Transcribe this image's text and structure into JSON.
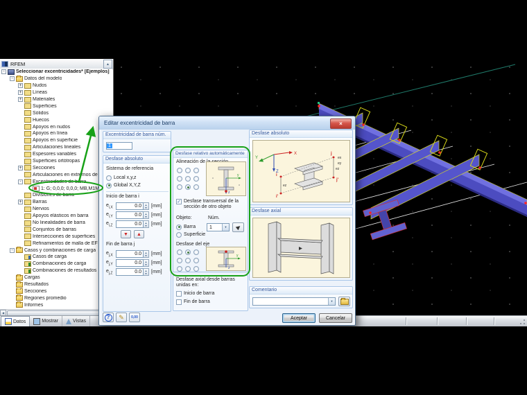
{
  "app": {
    "name": "RFEM"
  },
  "glyphs": {
    "close": "×",
    "spin_up": "▴",
    "spin_down": "▾",
    "combo_arrow": "▾",
    "scroll_up": "▲",
    "scroll_left": "◀",
    "scroll_right": "▶",
    "copy_down": "▼",
    "copy_up": "▲",
    "pencil": "✎",
    "help": "?",
    "units": "0,00",
    "check": "✓",
    "tree_plus": "+",
    "tree_minus": "-"
  },
  "colors": {
    "annotation_green": "#17a117",
    "beam_purple": "#5757c8",
    "beam_highlight_yellow": "#d8d818",
    "selection_blue": "#3399ff",
    "group_border": "#a9c6e8",
    "group_header_text": "#34589c",
    "viewport_black": "#000000",
    "node_red": "#ff2222",
    "construction_teal": "#1f7a6a"
  },
  "navigator": {
    "header": "RFEM",
    "tree": [
      {
        "label": "Seleccionar excentricidades* [Ejemplos]",
        "level": 0,
        "expand": "minus",
        "icon": "project",
        "bold": true
      },
      {
        "label": "Datos del modelo",
        "level": 1,
        "expand": "minus",
        "icon": "folder-open"
      },
      {
        "label": "Nudos",
        "level": 2,
        "expand": "plus",
        "icon": "nodes"
      },
      {
        "label": "Líneas",
        "level": 2,
        "expand": "plus",
        "icon": "lines"
      },
      {
        "label": "Materiales",
        "level": 2,
        "expand": "plus",
        "icon": "materials"
      },
      {
        "label": "Superficies",
        "level": 2,
        "expand": null,
        "icon": "surfaces"
      },
      {
        "label": "Sólidos",
        "level": 2,
        "expand": null,
        "icon": "solids"
      },
      {
        "label": "Huecos",
        "level": 2,
        "expand": null,
        "icon": "openings"
      },
      {
        "label": "Apoyos en nudos",
        "level": 2,
        "expand": null,
        "icon": "nodal-supports"
      },
      {
        "label": "Apoyos en línea",
        "level": 2,
        "expand": null,
        "icon": "line-supports"
      },
      {
        "label": "Apoyos en superficie",
        "level": 2,
        "expand": null,
        "icon": "surface-supports"
      },
      {
        "label": "Articulaciones lineales",
        "level": 2,
        "expand": null,
        "icon": "line-hinges"
      },
      {
        "label": "Espesores variables",
        "level": 2,
        "expand": null,
        "icon": "variable-thickness"
      },
      {
        "label": "Superficies ortótropas",
        "level": 2,
        "expand": null,
        "icon": "orthotropic"
      },
      {
        "label": "Secciones",
        "level": 2,
        "expand": "plus",
        "icon": "cross-sections"
      },
      {
        "label": "Articulaciones en extremos de barra",
        "level": 2,
        "expand": null,
        "icon": "member-hinges"
      },
      {
        "label": "Excentricidades de barra",
        "level": 2,
        "expand": "minus",
        "icon": "eccentricities"
      },
      {
        "label": "1: G; 0,0,0; 0,0,0; MB,M1MT",
        "level": 3,
        "expand": null,
        "icon": "eccentricity-item",
        "circled": true
      },
      {
        "label": "Divisiones de barra",
        "level": 2,
        "expand": null,
        "icon": "divisions"
      },
      {
        "label": "Barras",
        "level": 2,
        "expand": "plus",
        "icon": "members"
      },
      {
        "label": "Nervios",
        "level": 2,
        "expand": null,
        "icon": "ribs"
      },
      {
        "label": "Apoyos elásticos en barra",
        "level": 2,
        "expand": null,
        "icon": "elastic-foundations"
      },
      {
        "label": "No linealidades de barra",
        "level": 2,
        "expand": null,
        "icon": "nonlinearities"
      },
      {
        "label": "Conjuntos de barras",
        "level": 2,
        "expand": null,
        "icon": "member-sets"
      },
      {
        "label": "Intersecciones de superficies",
        "level": 2,
        "expand": null,
        "icon": "intersections"
      },
      {
        "label": "Refinamientos de malla de EF",
        "level": 2,
        "expand": null,
        "icon": "mesh-refinements"
      },
      {
        "label": "Casos y combinaciones de carga",
        "level": 1,
        "expand": "minus",
        "icon": "folder-open"
      },
      {
        "label": "Casos de carga",
        "level": 2,
        "expand": null,
        "icon": "load-cases"
      },
      {
        "label": "Combinaciones de carga",
        "level": 2,
        "expand": null,
        "icon": "load-combinations"
      },
      {
        "label": "Combinaciones de resultados",
        "level": 2,
        "expand": null,
        "icon": "result-combinations"
      },
      {
        "label": "Cargas",
        "level": 1,
        "expand": null,
        "icon": "folder"
      },
      {
        "label": "Resultados",
        "level": 1,
        "expand": null,
        "icon": "folder"
      },
      {
        "label": "Secciones",
        "level": 1,
        "expand": null,
        "icon": "folder"
      },
      {
        "label": "Regiones promedio",
        "level": 1,
        "expand": null,
        "icon": "folder"
      },
      {
        "label": "Informes",
        "level": 1,
        "expand": null,
        "icon": "folder"
      }
    ],
    "tabs": [
      {
        "label": "Datos",
        "icon": "data-tab-icon",
        "active": true
      },
      {
        "label": "Mostrar",
        "icon": "display-tab-icon",
        "active": false
      },
      {
        "label": "Vistas",
        "icon": "views-tab-icon",
        "active": false
      }
    ]
  },
  "dialog": {
    "title": "Editar excentricidad de barra",
    "number_group": {
      "label": "Excentricidad de barra núm.",
      "value": "1"
    },
    "absolute_group": {
      "title": "Desfase absoluto",
      "reference_label": "Sistema de referencia",
      "options": [
        {
          "label": "Local x,y,z",
          "selected": false
        },
        {
          "label": "Global X,Y,Z",
          "selected": true
        }
      ],
      "start_label": "Inicio de barra i",
      "end_label": "Fin de barra j",
      "unit": "[mm]",
      "start_fields": [
        {
          "base": "e",
          "sub": "i,X",
          "value": "0.0"
        },
        {
          "base": "e",
          "sub": "i,Y",
          "value": "0.0"
        },
        {
          "base": "e",
          "sub": "i,Z",
          "value": "0.0"
        }
      ],
      "end_fields": [
        {
          "base": "e",
          "sub": "j,X",
          "value": "0.0"
        },
        {
          "base": "e",
          "sub": "j,Y",
          "value": "0.0"
        },
        {
          "base": "e",
          "sub": "j,Z",
          "value": "0.0"
        }
      ]
    },
    "relative_group": {
      "title": "Desfase relativo automáticamente",
      "alignment_label": "Alineación de la sección",
      "alignment_selected": 7,
      "transverse_checkbox": {
        "label": "Desfase transversal de la sección de otro objeto",
        "checked": true
      },
      "object_label": "Objeto:",
      "num_label": "Núm.",
      "object_options": [
        {
          "label": "Barra",
          "selected": true
        },
        {
          "label": "Superficie",
          "selected": false
        }
      ],
      "num_value": "1",
      "axis_label": "Desfase del eje",
      "axis_selected": 1
    },
    "axial_from_group": {
      "title": "Desfase axial desde barras unidas en:",
      "checkboxes": [
        {
          "label": "Inicio de barra",
          "checked": false
        },
        {
          "label": "Fin de barra",
          "checked": false
        }
      ]
    },
    "absolute_diagram_title": "Desfase absoluto",
    "axial_diagram_title": "Desfase axial",
    "comment_group": {
      "title": "Comentario",
      "value": ""
    },
    "diagram_labels": {
      "x": "X",
      "y": "Y",
      "z": "Z",
      "i": "i",
      "j": "j",
      "i2": "i'",
      "j2": "j'",
      "ex": "ex",
      "ey": "ey",
      "ez": "ez",
      "sy": "y",
      "sz": "z"
    },
    "buttons": {
      "ok": "Aceptar",
      "cancel": "Cancelar"
    }
  }
}
